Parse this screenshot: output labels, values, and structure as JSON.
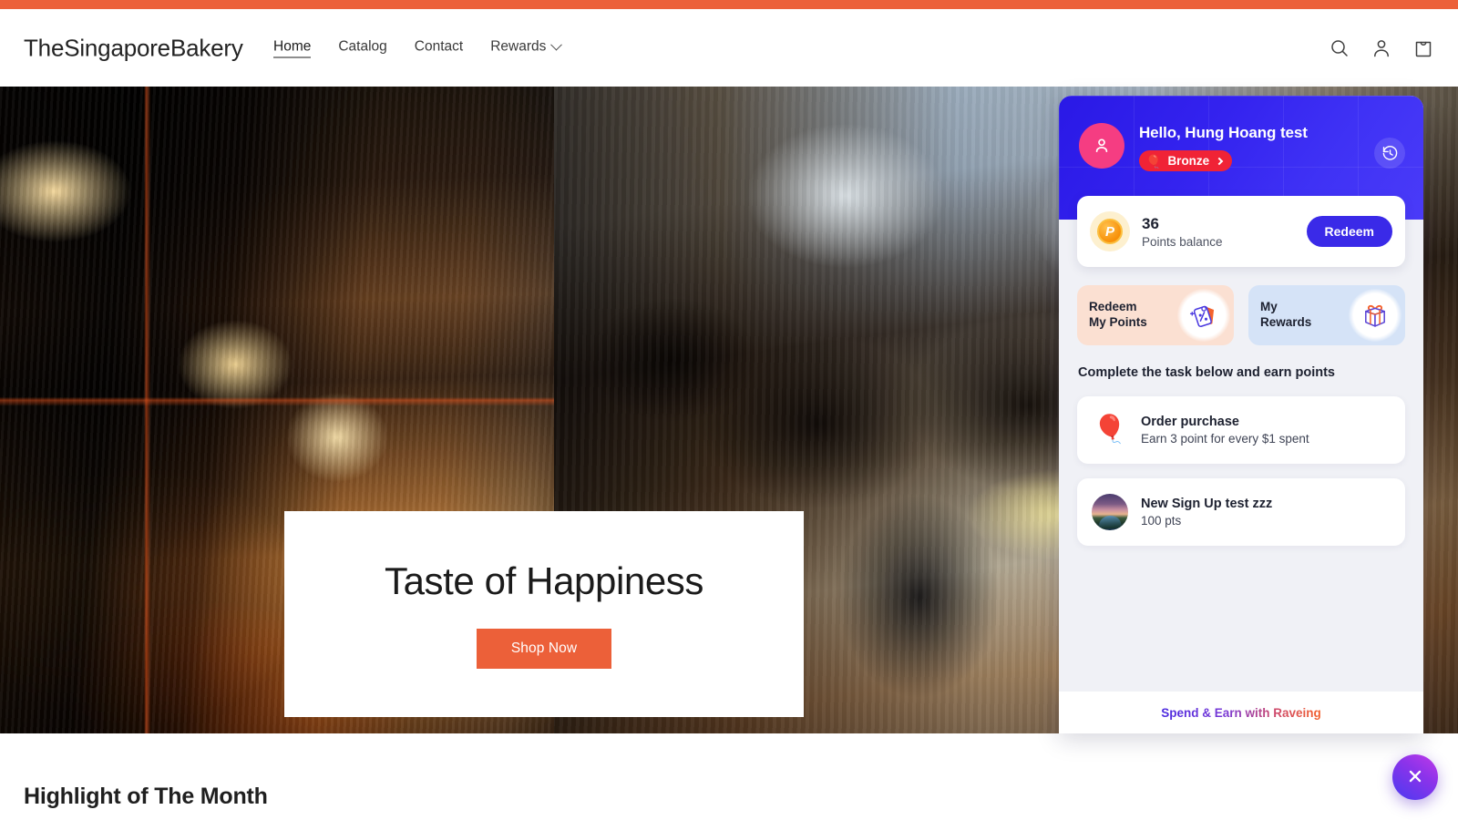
{
  "header": {
    "brand": "TheSingaporeBakery",
    "nav": [
      {
        "label": "Home",
        "active": true
      },
      {
        "label": "Catalog",
        "active": false
      },
      {
        "label": "Contact",
        "active": false
      },
      {
        "label": "Rewards",
        "active": false,
        "has_dropdown": true
      }
    ],
    "actions": [
      {
        "name": "search-icon",
        "label": "Search"
      },
      {
        "name": "account-icon",
        "label": "Log in"
      },
      {
        "name": "cart-icon",
        "label": "Cart"
      }
    ],
    "accent_color": "#ec6039"
  },
  "hero": {
    "title": "Taste of Happiness",
    "cta_label": "Shop Now",
    "cta_color": "#ec6039",
    "image_alt": "Bakery interior with pendant lamps and pastry display"
  },
  "section": {
    "heading": "Highlight of The Month"
  },
  "loyalty_widget": {
    "greeting": "Hello, Hung Hoang test",
    "tier_badge": {
      "label": "Bronze",
      "icon": "balloon",
      "color": "#f02336"
    },
    "history_icon": "clock-rewind-icon",
    "header_color": "#3423ef",
    "avatar_color": "#f53d82",
    "points": {
      "value": "36",
      "label": "Points balance",
      "redeem_label": "Redeem",
      "redeem_color": "#3a2ae8",
      "coin_glyph": "P"
    },
    "quick_actions": [
      {
        "label": "Redeem\nMy Points",
        "icon": "discount-tag-icon",
        "bg": "#fbe0d2"
      },
      {
        "label": "My\nRewards",
        "icon": "gift-box-icon",
        "bg": "#d5e3f7"
      }
    ],
    "tasks_heading": "Complete the task below and earn points",
    "tasks": [
      {
        "title": "Order purchase",
        "subtitle": "Earn 3 point for every $1 spent",
        "icon": "red-balloon-icon"
      },
      {
        "title": "New Sign Up test zzz",
        "subtitle": "100 pts",
        "icon": "landscape-photo-thumbnail"
      }
    ],
    "footer_link": "Spend & Earn with Raveing"
  },
  "fab": {
    "icon": "close-icon",
    "label": "Close"
  }
}
